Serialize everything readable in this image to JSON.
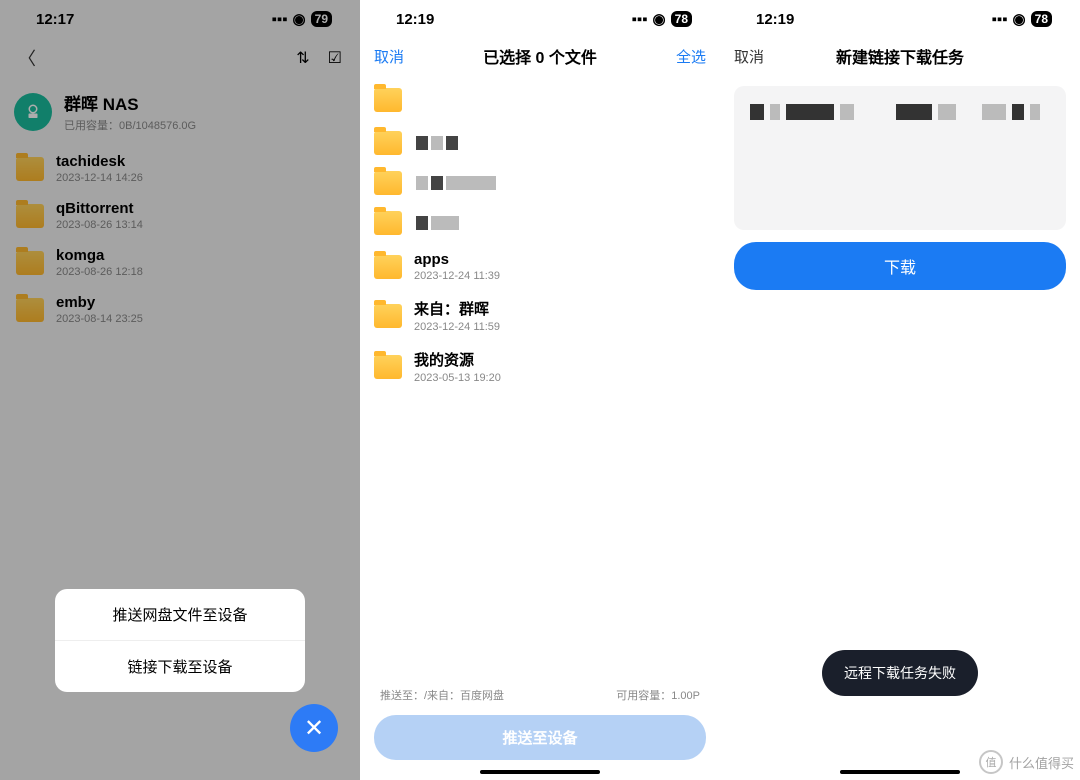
{
  "phone1": {
    "status": {
      "time": "12:17",
      "battery": "79"
    },
    "nas": {
      "title": "群晖 NAS",
      "sub": "已用容量：0B/1048576.0G"
    },
    "folders": [
      {
        "name": "tachidesk",
        "date": "2023-12-14 14:26"
      },
      {
        "name": "qBittorrent",
        "date": "2023-08-26 13:14"
      },
      {
        "name": "komga",
        "date": "2023-08-26 12:18"
      },
      {
        "name": "emby",
        "date": "2023-08-14 23:25"
      }
    ],
    "sheet": {
      "opt1": "推送网盘文件至设备",
      "opt2": "链接下载至设备"
    },
    "close": "✕"
  },
  "phone2": {
    "status": {
      "time": "12:19",
      "battery": "78"
    },
    "topbar": {
      "cancel": "取消",
      "title": "已选择 0 个文件",
      "all": "全选"
    },
    "folders": [
      {
        "name": "apps",
        "date": "2023-12-24 11:39"
      },
      {
        "name": "来自：群晖",
        "date": "2023-12-24 11:59"
      },
      {
        "name": "我的资源",
        "date": "2023-05-13 19:20"
      }
    ],
    "footer": {
      "left": "推送至：/来自：百度网盘",
      "right": "可用容量：1.00P",
      "button": "推送至设备"
    }
  },
  "phone3": {
    "status": {
      "time": "12:19",
      "battery": "78"
    },
    "topbar": {
      "cancel": "取消",
      "title": "新建链接下载任务"
    },
    "dl_button": "下载",
    "toast": "远程下载任务失败"
  },
  "watermark": {
    "label": "值",
    "text": "什么值得买"
  }
}
